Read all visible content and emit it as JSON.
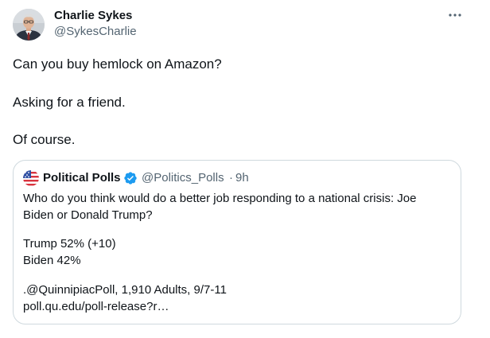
{
  "tweet": {
    "author": {
      "name": "Charlie Sykes",
      "handle": "@SykesCharlie"
    },
    "more_icon": "ellipsis-horizontal-icon",
    "text_lines": [
      "Can you buy hemlock on Amazon?",
      "Asking for a friend.",
      "Of course."
    ]
  },
  "quoted_tweet": {
    "author": {
      "name": "Political Polls",
      "handle": "@Politics_Polls",
      "verified": true
    },
    "separator": "·",
    "time": "9h",
    "text_lines": [
      "Who do you think would do a better job responding to a national crisis: Joe",
      "Biden or Donald Trump?",
      "Trump 52% (+10)",
      "Biden 42%",
      ".@QuinnipiacPoll, 1,910 Adults, 9/7-11",
      "poll.qu.edu/poll-release?r…"
    ]
  },
  "colors": {
    "text_primary": "#0f1419",
    "text_secondary": "#536471",
    "border": "#cfd9de",
    "verified_blue": "#1d9bf0"
  }
}
